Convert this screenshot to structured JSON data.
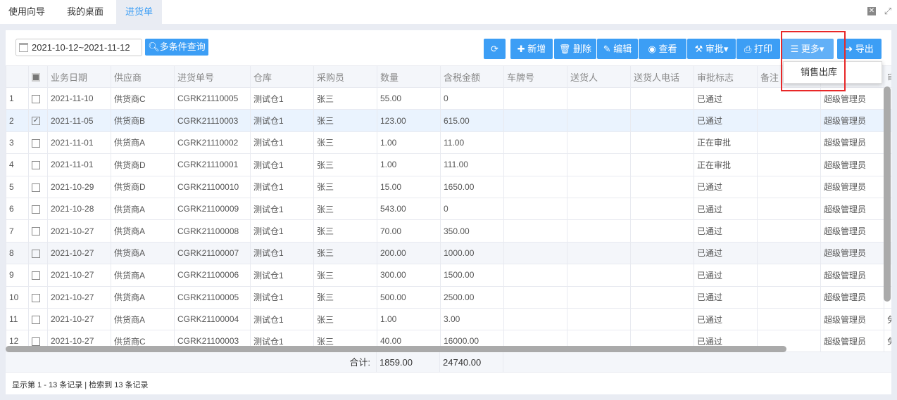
{
  "tabs": [
    {
      "label": "使用向导",
      "active": false
    },
    {
      "label": "我的桌面",
      "active": false
    },
    {
      "label": "进货单",
      "active": true
    }
  ],
  "window_icons": [
    "close-icon",
    "fullscreen-icon"
  ],
  "toolbar": {
    "date_range": "2021-10-12~2021-11-12",
    "query_label": "多条件查询",
    "refresh_icon": "refresh-icon",
    "buttons": [
      {
        "label": "新增",
        "icon": "plus-icon"
      },
      {
        "label": "删除",
        "icon": "trash-icon"
      },
      {
        "label": "编辑",
        "icon": "edit-icon"
      },
      {
        "label": "查看",
        "icon": "eye-icon"
      },
      {
        "label": "审批▾",
        "icon": "gavel-icon"
      },
      {
        "label": "打印",
        "icon": "print-icon"
      },
      {
        "label": "更多▾",
        "icon": "menu-icon"
      },
      {
        "label": "导出",
        "icon": "export-icon"
      }
    ],
    "more_menu": [
      "销售出库"
    ]
  },
  "table": {
    "columns": [
      "",
      "",
      "业务日期",
      "供应商",
      "进货单号",
      "仓库",
      "采购员",
      "数量",
      "含税金额",
      "车牌号",
      "送货人",
      "送货人电话",
      "审批标志",
      "备注",
      "",
      "审"
    ],
    "rows": [
      [
        "1",
        false,
        "2021-11-10",
        "供货商C",
        "CGRK21110005",
        "测试仓1",
        "张三",
        "55.00",
        "0",
        "",
        "",
        "",
        "已通过",
        "",
        "超级管理员",
        ""
      ],
      [
        "2",
        true,
        "2021-11-05",
        "供货商B",
        "CGRK21110003",
        "测试仓1",
        "张三",
        "123.00",
        "615.00",
        "",
        "",
        "",
        "已通过",
        "",
        "超级管理员",
        ""
      ],
      [
        "3",
        false,
        "2021-11-01",
        "供货商A",
        "CGRK21110002",
        "测试仓1",
        "张三",
        "1.00",
        "11.00",
        "",
        "",
        "",
        "正在审批",
        "",
        "超级管理员",
        ""
      ],
      [
        "4",
        false,
        "2021-11-01",
        "供货商D",
        "CGRK21110001",
        "测试仓1",
        "张三",
        "1.00",
        "111.00",
        "",
        "",
        "",
        "正在审批",
        "",
        "超级管理员",
        ""
      ],
      [
        "5",
        false,
        "2021-10-29",
        "供货商D",
        "CGRK21100010",
        "测试仓1",
        "张三",
        "15.00",
        "1650.00",
        "",
        "",
        "",
        "已通过",
        "",
        "超级管理员",
        ""
      ],
      [
        "6",
        false,
        "2021-10-28",
        "供货商A",
        "CGRK21100009",
        "测试仓1",
        "张三",
        "543.00",
        "0",
        "",
        "",
        "",
        "已通过",
        "",
        "超级管理员",
        ""
      ],
      [
        "7",
        false,
        "2021-10-27",
        "供货商A",
        "CGRK21100008",
        "测试仓1",
        "张三",
        "70.00",
        "350.00",
        "",
        "",
        "",
        "已通过",
        "",
        "超级管理员",
        ""
      ],
      [
        "8",
        false,
        "2021-10-27",
        "供货商A",
        "CGRK21100007",
        "测试仓1",
        "张三",
        "200.00",
        "1000.00",
        "",
        "",
        "",
        "已通过",
        "",
        "超级管理员",
        ""
      ],
      [
        "9",
        false,
        "2021-10-27",
        "供货商A",
        "CGRK21100006",
        "测试仓1",
        "张三",
        "300.00",
        "1500.00",
        "",
        "",
        "",
        "已通过",
        "",
        "超级管理员",
        ""
      ],
      [
        "10",
        false,
        "2021-10-27",
        "供货商A",
        "CGRK21100005",
        "测试仓1",
        "张三",
        "500.00",
        "2500.00",
        "",
        "",
        "",
        "已通过",
        "",
        "超级管理员",
        ""
      ],
      [
        "11",
        false,
        "2021-10-27",
        "供货商A",
        "CGRK21100004",
        "测试仓1",
        "张三",
        "1.00",
        "3.00",
        "",
        "",
        "",
        "已通过",
        "",
        "超级管理员",
        "免"
      ],
      [
        "12",
        false,
        "2021-10-27",
        "供货商C",
        "CGRK21100003",
        "测试仓1",
        "张三",
        "40.00",
        "16000.00",
        "",
        "",
        "",
        "已通过",
        "",
        "超级管理员",
        "免"
      ]
    ],
    "total_label": "合计:",
    "total_qty": "1859.00",
    "total_amount": "24740.00"
  },
  "status": "显示第 1 - 13 条记录 | 检索到 13 条记录"
}
